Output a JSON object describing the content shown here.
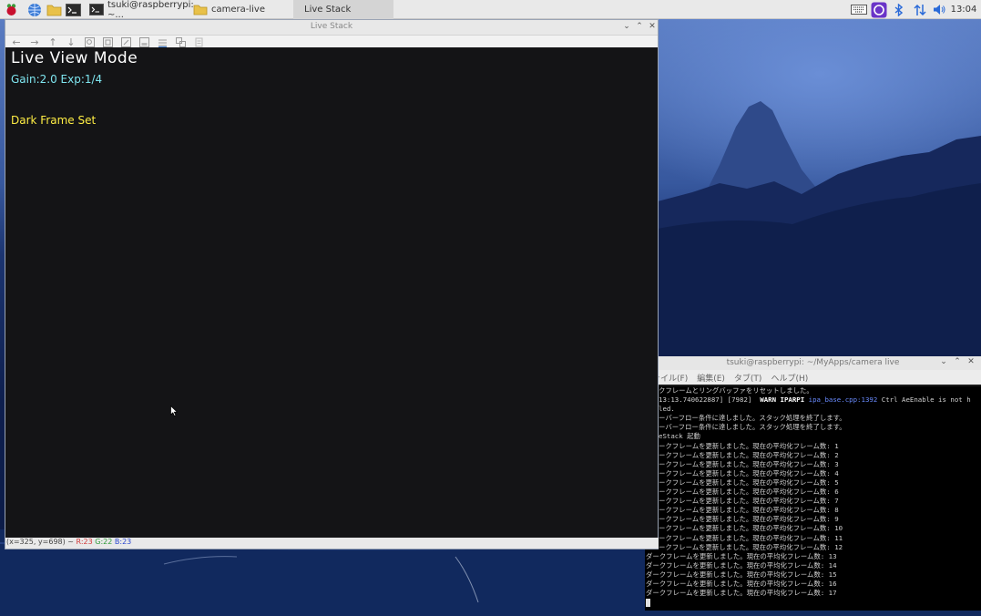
{
  "taskbar": {
    "tasks": [
      {
        "label": "tsuki@raspberrypi: ~..."
      },
      {
        "label": "camera-live"
      },
      {
        "label": "Live Stack"
      }
    ],
    "clock": "13:04"
  },
  "viewer_window": {
    "title": "Live Stack",
    "overlay": {
      "mode": "Live View Mode",
      "gain_exp": "Gain:2.0 Exp:1/4",
      "dark_frame": "Dark Frame Set"
    },
    "status": {
      "coords": "(x=325, y=698) ~",
      "r": "R:23",
      "g": "G:22",
      "b": "B:23"
    }
  },
  "terminal": {
    "title": "tsuki@raspberrypi: ~/MyApps/camera live",
    "menu": [
      "ァイル(F)",
      "編集(E)",
      "タブ(T)",
      "ヘルプ(H)"
    ],
    "lines": [
      "クフレームとリングバッファをリセットしました。",
      "13:13.740622887] [7982]",
      "led.",
      "ーバーフロー条件に達しました。スタック処理を終了します。",
      "ーバーフロー条件に達しました。スタック処理を終了します。",
      "eStack 起動",
      "ークフレームを更新しました。現在の平均化フレーム数: 1",
      "ークフレームを更新しました。現在の平均化フレーム数: 2",
      "ークフレームを更新しました。現在の平均化フレーム数: 3",
      "ークフレームを更新しました。現在の平均化フレーム数: 4",
      "ークフレームを更新しました。現在の平均化フレーム数: 5",
      "ークフレームを更新しました。現在の平均化フレーム数: 6",
      "ークフレームを更新しました。現在の平均化フレーム数: 7",
      "ークフレームを更新しました。現在の平均化フレーム数: 8",
      "ークフレームを更新しました。現在の平均化フレーム数: 9",
      "ークフレームを更新しました。現在の平均化フレーム数: 10",
      "ークフレームを更新しました。現在の平均化フレーム数: 11",
      "ークフレームを更新しました。現在の平均化フレーム数: 12",
      "ダークフレームを更新しました。現在の平均化フレーム数: 13",
      "ダークフレームを更新しました。現在の平均化フレーム数: 14",
      "ダークフレームを更新しました。現在の平均化フレーム数: 15",
      "ダークフレームを更新しました。現在の平均化フレーム数: 16",
      "ダークフレームを更新しました。現在の平均化フレーム数: 17"
    ],
    "warn_tag": "WARN IPARPI",
    "warn_file": "ipa_base.cpp:1392",
    "warn_msg": "Ctrl AeEnable is not h"
  }
}
